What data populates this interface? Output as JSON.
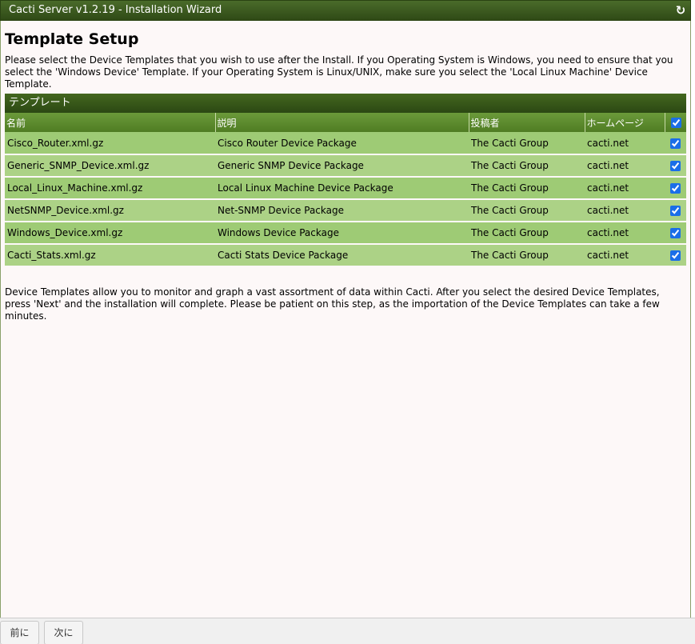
{
  "window": {
    "title": "Cacti Server v1.2.19 - Installation Wizard"
  },
  "page": {
    "title": "Template Setup",
    "intro": "Please select the Device Templates that you wish to use after the Install. If you Operating System is Windows, you need to ensure that you select the 'Windows Device' Template. If your Operating System is Linux/UNIX, make sure you select the 'Local Linux Machine' Device Template.",
    "outro": "Device Templates allow you to monitor and graph a vast assortment of data within Cacti. After you select the desired Device Templates, press 'Next' and the installation will complete. Please be patient on this step, as the importation of the Device Templates can take a few minutes."
  },
  "panel": {
    "title": "テンプレート",
    "columns": [
      "名前",
      "説明",
      "投稿者",
      "ホームページ"
    ],
    "select_all_checked": true,
    "rows": [
      {
        "name": "Cisco_Router.xml.gz",
        "description": "Cisco Router Device Package",
        "author": "The Cacti Group",
        "homepage": "cacti.net",
        "checked": true
      },
      {
        "name": "Generic_SNMP_Device.xml.gz",
        "description": "Generic SNMP Device Package",
        "author": "The Cacti Group",
        "homepage": "cacti.net",
        "checked": true
      },
      {
        "name": "Local_Linux_Machine.xml.gz",
        "description": "Local Linux Machine Device Package",
        "author": "The Cacti Group",
        "homepage": "cacti.net",
        "checked": true
      },
      {
        "name": "NetSNMP_Device.xml.gz",
        "description": "Net-SNMP Device Package",
        "author": "The Cacti Group",
        "homepage": "cacti.net",
        "checked": true
      },
      {
        "name": "Windows_Device.xml.gz",
        "description": "Windows Device Package",
        "author": "The Cacti Group",
        "homepage": "cacti.net",
        "checked": true
      },
      {
        "name": "Cacti_Stats.xml.gz",
        "description": "Cacti Stats Device Package",
        "author": "The Cacti Group",
        "homepage": "cacti.net",
        "checked": true
      }
    ]
  },
  "footer": {
    "prev_label": "前に",
    "next_label": "次に"
  },
  "icons": {
    "refresh": "refresh-icon"
  },
  "colors": {
    "header_dark": "#2f4a16",
    "row_green": "#9ecb75",
    "row_green_alt": "#acd286",
    "checkbox_blue": "#1a6ee8"
  }
}
